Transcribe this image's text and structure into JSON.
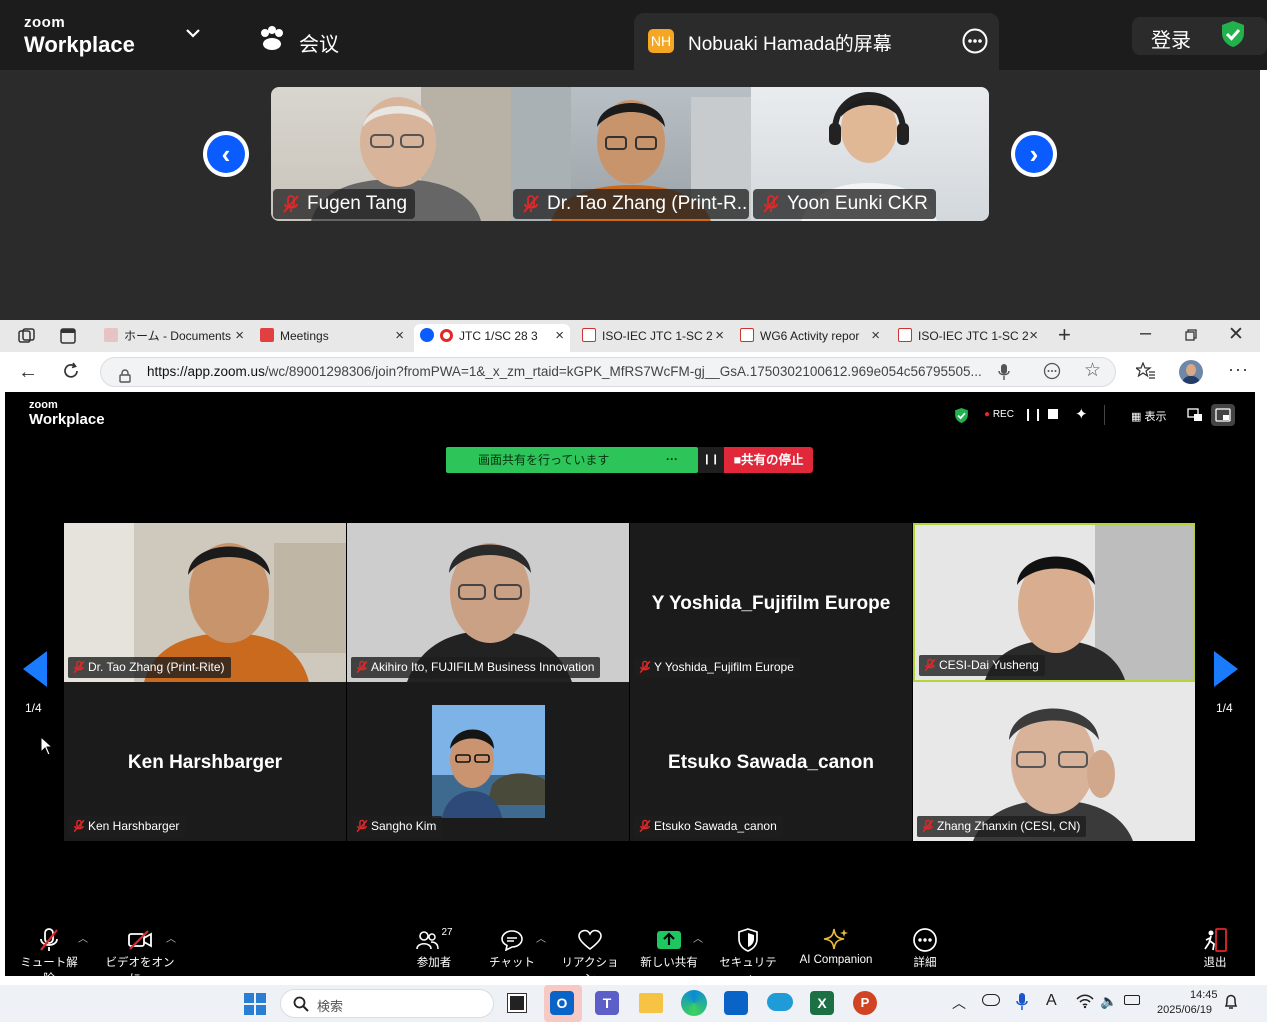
{
  "zoom_app": {
    "logo_top": "zoom",
    "logo_bottom": "Workplace",
    "meeting_label": "会议",
    "share_tab_initials": "NH",
    "share_tab_title": "Nobuaki Hamada的屏幕",
    "signin_label": "登录"
  },
  "top_participants": [
    {
      "name": "Fugen Tang"
    },
    {
      "name": "Dr. Tao Zhang (Print-R..."
    },
    {
      "name": "Yoon Eunki CKR"
    }
  ],
  "browser": {
    "tabs": [
      {
        "title": "ホーム - Documents"
      },
      {
        "title": "Meetings"
      },
      {
        "title": "JTC 1/SC 28 3"
      },
      {
        "title": "ISO-IEC JTC 1-SC 2"
      },
      {
        "title": "WG6 Activity repor"
      },
      {
        "title": "ISO-IEC JTC 1-SC 2"
      }
    ],
    "url_host": "https://app.zoom.us",
    "url_path": "/wc/89001298306/join?fromPWA=1&_x_zm_rtaid=kGPK_MfRS7WcFM-gj__GsA.1750302100612.969e054c56795505..."
  },
  "web_client": {
    "logo_top": "zoom",
    "logo_bottom": "Workplace",
    "rec_label": "REC",
    "view_label": "表示",
    "sharing_status": "画面共有を行っています",
    "stop_share_label": "共有の停止",
    "page_left": "1/4",
    "page_right": "1/4",
    "tiles": [
      {
        "name": "Dr. Tao Zhang (Print-Rite)",
        "big": ""
      },
      {
        "name": "Akihiro Ito, FUJIFILM Business Innovation",
        "big": ""
      },
      {
        "name": "Y Yoshida_Fujifilm Europe",
        "big": "Y Yoshida_Fujifilm Europe"
      },
      {
        "name": "CESI-Dai Yusheng",
        "big": ""
      },
      {
        "name": "Ken Harshbarger",
        "big": "Ken Harshbarger"
      },
      {
        "name": "Sangho Kim",
        "big": ""
      },
      {
        "name": "Etsuko Sawada_canon",
        "big": "Etsuko Sawada_canon"
      },
      {
        "name": "Zhang Zhanxin (CESI, CN)",
        "big": ""
      }
    ],
    "toolbar": {
      "unmute": "ミュート解除",
      "video_on": "ビデオをオンに...",
      "participants": "参加者",
      "participants_count": "27",
      "chat": "チャット",
      "reactions": "リアクション",
      "new_share": "新しい共有",
      "security": "セキュリティ",
      "ai_companion": "AI Companion",
      "more": "詳細",
      "leave": "退出"
    }
  },
  "taskbar": {
    "search_placeholder": "検索",
    "time": "14:45",
    "date": "2025/06/19",
    "ime": "A"
  }
}
